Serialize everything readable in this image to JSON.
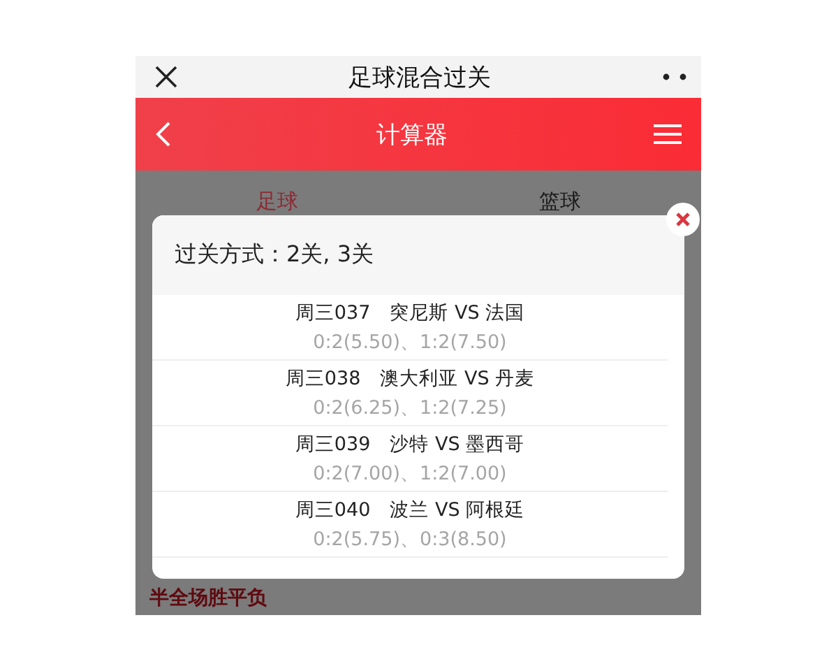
{
  "top_bar": {
    "title": "足球混合过关"
  },
  "header": {
    "title": "计算器"
  },
  "tabs": [
    {
      "label": "足球",
      "selected": true
    },
    {
      "label": "篮球",
      "selected": false
    }
  ],
  "background_label": "半全场胜平负",
  "dialog": {
    "title": "过关方式：2关, 3关",
    "matches": [
      {
        "match": "周三037　突尼斯 VS 法国",
        "picks": "0:2(5.50)、1:2(7.50)"
      },
      {
        "match": "周三038　澳大利亚 VS 丹麦",
        "picks": "0:2(6.25)、1:2(7.25)"
      },
      {
        "match": "周三039　沙特 VS 墨西哥",
        "picks": "0:2(7.00)、1:2(7.00)"
      },
      {
        "match": "周三040　波兰 VS 阿根廷",
        "picks": "0:2(5.75)、0:3(8.50)"
      }
    ]
  }
}
